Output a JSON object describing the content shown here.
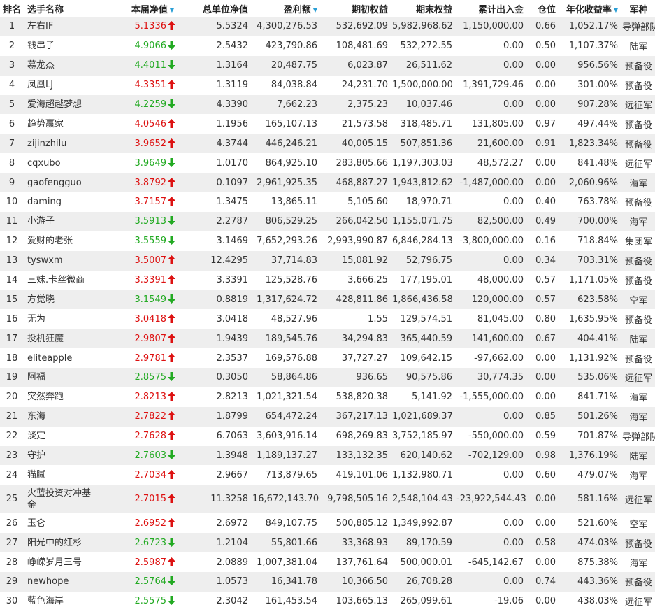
{
  "header": {
    "rank": "排名",
    "name": "选手名称",
    "nav": "本届净值",
    "unit_nav": "总单位净值",
    "profit": "盈利额",
    "start_equity": "期初权益",
    "end_equity": "期末权益",
    "cum_flow": "累计出入金",
    "position": "仓位",
    "annual_return": "年化收益率",
    "branch": "军种"
  },
  "colors": {
    "up": "#dd1111",
    "down": "#22aa22",
    "row_alt": "#eeeeee",
    "sort_icon": "#2a9fd6"
  },
  "icons": {
    "up": "arrow-up-icon",
    "down": "arrow-down-icon",
    "sort": "sort-desc-icon"
  },
  "rows": [
    {
      "rank": "1",
      "name": "左右IF",
      "nav": "5.1336",
      "dir": "up",
      "unit_nav": "5.5324",
      "profit": "4,300,276.53",
      "start": "532,692.09",
      "end": "5,982,968.62",
      "flow": "1,150,000.00",
      "pos": "0.66",
      "annual": "1,052.17%",
      "branch": "导弹部队"
    },
    {
      "rank": "2",
      "name": "钱串子",
      "nav": "4.9066",
      "dir": "down",
      "unit_nav": "2.5432",
      "profit": "423,790.86",
      "start": "108,481.69",
      "end": "532,272.55",
      "flow": "0.00",
      "pos": "0.50",
      "annual": "1,107.37%",
      "branch": "陆军"
    },
    {
      "rank": "3",
      "name": "慕龙杰",
      "nav": "4.4011",
      "dir": "down",
      "unit_nav": "1.3164",
      "profit": "20,487.75",
      "start": "6,023.87",
      "end": "26,511.62",
      "flow": "0.00",
      "pos": "0.00",
      "annual": "956.56%",
      "branch": "预备役"
    },
    {
      "rank": "4",
      "name": "凤凰LJ",
      "nav": "4.3351",
      "dir": "up",
      "unit_nav": "1.3119",
      "profit": "84,038.84",
      "start": "24,231.70",
      "end": "1,500,000.00",
      "flow": "1,391,729.46",
      "pos": "0.00",
      "annual": "301.00%",
      "branch": "预备役"
    },
    {
      "rank": "5",
      "name": "爱海超越梦想",
      "nav": "4.2259",
      "dir": "down",
      "unit_nav": "4.3390",
      "profit": "7,662.23",
      "start": "2,375.23",
      "end": "10,037.46",
      "flow": "0.00",
      "pos": "0.00",
      "annual": "907.28%",
      "branch": "远征军"
    },
    {
      "rank": "6",
      "name": "趋势赢家",
      "nav": "4.0546",
      "dir": "up",
      "unit_nav": "1.1956",
      "profit": "165,107.13",
      "start": "21,573.58",
      "end": "318,485.71",
      "flow": "131,805.00",
      "pos": "0.97",
      "annual": "497.44%",
      "branch": "预备役"
    },
    {
      "rank": "7",
      "name": "zijinzhilu",
      "nav": "3.9652",
      "dir": "up",
      "unit_nav": "4.3744",
      "profit": "446,246.21",
      "start": "40,005.15",
      "end": "507,851.36",
      "flow": "21,600.00",
      "pos": "0.91",
      "annual": "1,823.34%",
      "branch": "预备役"
    },
    {
      "rank": "8",
      "name": "cqxubo",
      "nav": "3.9649",
      "dir": "down",
      "unit_nav": "1.0170",
      "profit": "864,925.10",
      "start": "283,805.66",
      "end": "1,197,303.03",
      "flow": "48,572.27",
      "pos": "0.00",
      "annual": "841.48%",
      "branch": "远征军"
    },
    {
      "rank": "9",
      "name": "gaofengguo",
      "nav": "3.8792",
      "dir": "up",
      "unit_nav": "0.1097",
      "profit": "2,961,925.35",
      "start": "468,887.27",
      "end": "1,943,812.62",
      "flow": "-1,487,000.00",
      "pos": "0.00",
      "annual": "2,060.96%",
      "branch": "海军"
    },
    {
      "rank": "10",
      "name": "daming",
      "nav": "3.7157",
      "dir": "up",
      "unit_nav": "1.3475",
      "profit": "13,865.11",
      "start": "5,105.60",
      "end": "18,970.71",
      "flow": "0.00",
      "pos": "0.40",
      "annual": "763.78%",
      "branch": "预备役"
    },
    {
      "rank": "11",
      "name": "小游子",
      "nav": "3.5913",
      "dir": "down",
      "unit_nav": "2.2787",
      "profit": "806,529.25",
      "start": "266,042.50",
      "end": "1,155,071.75",
      "flow": "82,500.00",
      "pos": "0.49",
      "annual": "700.00%",
      "branch": "海军"
    },
    {
      "rank": "12",
      "name": "爱财的老张",
      "nav": "3.5559",
      "dir": "down",
      "unit_nav": "3.1469",
      "profit": "7,652,293.26",
      "start": "2,993,990.87",
      "end": "6,846,284.13",
      "flow": "-3,800,000.00",
      "pos": "0.16",
      "annual": "718.84%",
      "branch": "集团军"
    },
    {
      "rank": "13",
      "name": "tyswxm",
      "nav": "3.5007",
      "dir": "up",
      "unit_nav": "12.4295",
      "profit": "37,714.83",
      "start": "15,081.92",
      "end": "52,796.75",
      "flow": "0.00",
      "pos": "0.34",
      "annual": "703.31%",
      "branch": "预备役"
    },
    {
      "rank": "14",
      "name": "三妹.卡丝微商",
      "nav": "3.3391",
      "dir": "up",
      "unit_nav": "3.3391",
      "profit": "125,528.76",
      "start": "3,666.25",
      "end": "177,195.01",
      "flow": "48,000.00",
      "pos": "0.57",
      "annual": "1,171.05%",
      "branch": "预备役"
    },
    {
      "rank": "15",
      "name": "方觉晓",
      "nav": "3.1549",
      "dir": "down",
      "unit_nav": "0.8819",
      "profit": "1,317,624.72",
      "start": "428,811.86",
      "end": "1,866,436.58",
      "flow": "120,000.00",
      "pos": "0.57",
      "annual": "623.58%",
      "branch": "空军"
    },
    {
      "rank": "16",
      "name": "无为",
      "nav": "3.0418",
      "dir": "up",
      "unit_nav": "3.0418",
      "profit": "48,527.96",
      "start": "1.55",
      "end": "129,574.51",
      "flow": "81,045.00",
      "pos": "0.80",
      "annual": "1,635.95%",
      "branch": "预备役"
    },
    {
      "rank": "17",
      "name": "投机狂魔",
      "nav": "2.9807",
      "dir": "up",
      "unit_nav": "1.9439",
      "profit": "189,545.76",
      "start": "34,294.83",
      "end": "365,440.59",
      "flow": "141,600.00",
      "pos": "0.67",
      "annual": "404.41%",
      "branch": "陆军"
    },
    {
      "rank": "18",
      "name": "eliteapple",
      "nav": "2.9781",
      "dir": "up",
      "unit_nav": "2.3537",
      "profit": "169,576.88",
      "start": "37,727.27",
      "end": "109,642.15",
      "flow": "-97,662.00",
      "pos": "0.00",
      "annual": "1,131.92%",
      "branch": "预备役"
    },
    {
      "rank": "19",
      "name": "阿福",
      "nav": "2.8575",
      "dir": "down",
      "unit_nav": "0.3050",
      "profit": "58,864.86",
      "start": "936.65",
      "end": "90,575.86",
      "flow": "30,774.35",
      "pos": "0.00",
      "annual": "535.06%",
      "branch": "远征军"
    },
    {
      "rank": "20",
      "name": "突然奔跑",
      "nav": "2.8213",
      "dir": "up",
      "unit_nav": "2.8213",
      "profit": "1,021,321.54",
      "start": "538,820.38",
      "end": "5,141.92",
      "flow": "-1,555,000.00",
      "pos": "0.00",
      "annual": "841.71%",
      "branch": "海军"
    },
    {
      "rank": "21",
      "name": "东海",
      "nav": "2.7822",
      "dir": "up",
      "unit_nav": "1.8799",
      "profit": "654,472.24",
      "start": "367,217.13",
      "end": "1,021,689.37",
      "flow": "0.00",
      "pos": "0.85",
      "annual": "501.26%",
      "branch": "海军"
    },
    {
      "rank": "22",
      "name": "淡定",
      "nav": "2.7628",
      "dir": "up",
      "unit_nav": "6.7063",
      "profit": "3,603,916.14",
      "start": "698,269.83",
      "end": "3,752,185.97",
      "flow": "-550,000.00",
      "pos": "0.59",
      "annual": "701.87%",
      "branch": "导弹部队"
    },
    {
      "rank": "23",
      "name": "守护",
      "nav": "2.7603",
      "dir": "down",
      "unit_nav": "1.3948",
      "profit": "1,189,137.27",
      "start": "133,132.35",
      "end": "620,140.62",
      "flow": "-702,129.00",
      "pos": "0.98",
      "annual": "1,376.19%",
      "branch": "陆军"
    },
    {
      "rank": "24",
      "name": "猫腻",
      "nav": "2.7034",
      "dir": "up",
      "unit_nav": "2.9667",
      "profit": "713,879.65",
      "start": "419,101.06",
      "end": "1,132,980.71",
      "flow": "0.00",
      "pos": "0.60",
      "annual": "479.07%",
      "branch": "海军"
    },
    {
      "rank": "25",
      "name": "火蓝投资对冲基金",
      "nav": "2.7015",
      "dir": "up",
      "unit_nav": "11.3258",
      "profit": "16,672,143.70",
      "start": "9,798,505.16",
      "end": "2,548,104.43",
      "flow": "-23,922,544.43",
      "pos": "0.00",
      "annual": "581.16%",
      "branch": "远征军",
      "tall": true
    },
    {
      "rank": "26",
      "name": "玉仑",
      "nav": "2.6952",
      "dir": "up",
      "unit_nav": "2.6972",
      "profit": "849,107.75",
      "start": "500,885.12",
      "end": "1,349,992.87",
      "flow": "0.00",
      "pos": "0.00",
      "annual": "521.60%",
      "branch": "空军"
    },
    {
      "rank": "27",
      "name": "阳光中的红杉",
      "nav": "2.6723",
      "dir": "down",
      "unit_nav": "1.2104",
      "profit": "55,801.66",
      "start": "33,368.93",
      "end": "89,170.59",
      "flow": "0.00",
      "pos": "0.58",
      "annual": "474.03%",
      "branch": "预备役"
    },
    {
      "rank": "28",
      "name": "峥嵘岁月三号",
      "nav": "2.5987",
      "dir": "up",
      "unit_nav": "2.0889",
      "profit": "1,007,381.04",
      "start": "137,761.64",
      "end": "500,000.01",
      "flow": "-645,142.67",
      "pos": "0.00",
      "annual": "875.38%",
      "branch": "海军"
    },
    {
      "rank": "29",
      "name": "newhope",
      "nav": "2.5764",
      "dir": "down",
      "unit_nav": "1.0573",
      "profit": "16,341.78",
      "start": "10,366.50",
      "end": "26,708.28",
      "flow": "0.00",
      "pos": "0.74",
      "annual": "443.36%",
      "branch": "预备役"
    },
    {
      "rank": "30",
      "name": "藍色海岸",
      "nav": "2.5575",
      "dir": "down",
      "unit_nav": "2.3042",
      "profit": "161,453.54",
      "start": "103,665.13",
      "end": "265,099.61",
      "flow": "-19.06",
      "pos": "0.00",
      "annual": "438.03%",
      "branch": "远征军"
    }
  ]
}
